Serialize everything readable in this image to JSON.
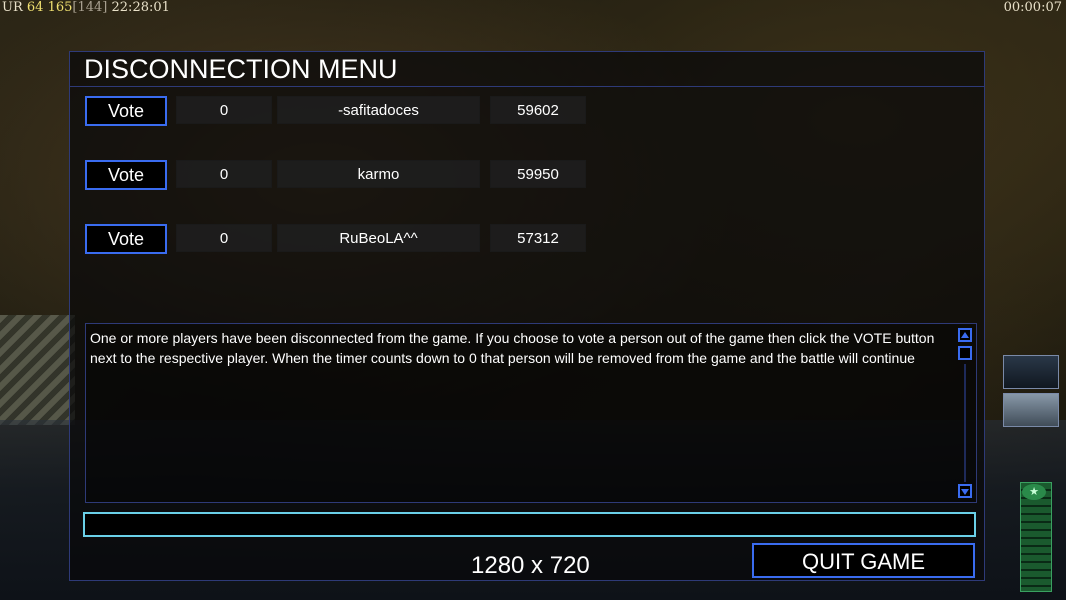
{
  "hud": {
    "tag": "UR",
    "fps": "64",
    "frame": "165",
    "ping": "[144]",
    "clock": "22:28:01",
    "timer": "00:00:07"
  },
  "dialog": {
    "title": "DISCONNECTION MENU",
    "players": [
      {
        "vote_label": "Vote",
        "votes": "0",
        "name": "-safitadoces",
        "timeout": "59602"
      },
      {
        "vote_label": "Vote",
        "votes": "0",
        "name": "karmo",
        "timeout": "59950"
      },
      {
        "vote_label": "Vote",
        "votes": "0",
        "name": "RuBeoLA^^",
        "timeout": "57312"
      }
    ],
    "message": "One or more players have been disconnected from the game. If you choose to vote a person out of the game then click the VOTE button next to the respective player. When the timer counts down to 0 that person will be removed from the game and the battle will continue",
    "chat_value": "",
    "resolution": "1280 x 720",
    "quit_label": "QUIT GAME"
  },
  "colors": {
    "accent": "#3a6cf0",
    "chat_border": "#6ad0e8",
    "fps": "#f0e070"
  },
  "icons": {
    "scroll_up": "arrow-up-icon",
    "scroll_down": "arrow-down-icon",
    "side_unit_1": "artillery-icon",
    "side_unit_2": "drone-icon",
    "power": "power-meter-icon"
  }
}
